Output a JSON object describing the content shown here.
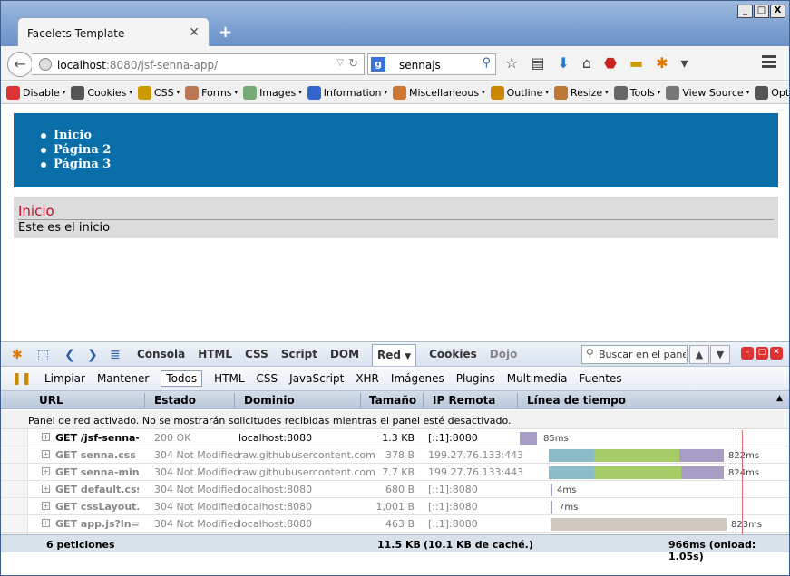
{
  "window": {
    "tab_title": "Facelets Template",
    "controls": [
      "_",
      "□",
      "X"
    ]
  },
  "nav": {
    "url_host": "localhost",
    "url_rest": ":8080/jsf-senna-app/",
    "search_value": "sennajs"
  },
  "webdev_toolbar": [
    {
      "label": "Disable",
      "color": "#d33"
    },
    {
      "label": "Cookies",
      "color": "#555"
    },
    {
      "label": "CSS",
      "color": "#c90"
    },
    {
      "label": "Forms",
      "color": "#b75"
    },
    {
      "label": "Images",
      "color": "#7a7"
    },
    {
      "label": "Information",
      "color": "#36c"
    },
    {
      "label": "Miscellaneous",
      "color": "#c73"
    },
    {
      "label": "Outline",
      "color": "#c80"
    },
    {
      "label": "Resize",
      "color": "#b73"
    },
    {
      "label": "Tools",
      "color": "#666"
    },
    {
      "label": "View Source",
      "color": "#777"
    },
    {
      "label": "Options",
      "color": "#555"
    }
  ],
  "page": {
    "menu": [
      "Inicio",
      "Página 2",
      "Página 3"
    ],
    "panel_title": "Inicio",
    "panel_body": "Este es el inicio"
  },
  "firebug": {
    "tabs": [
      "Consola",
      "HTML",
      "CSS",
      "Script",
      "DOM",
      "Red",
      "Cookies",
      "Dojo"
    ],
    "active_tab": "Red",
    "search_placeholder": "Buscar en el panel R",
    "sub_buttons": [
      "Limpiar",
      "Mantener"
    ],
    "filters": [
      "Todos",
      "HTML",
      "CSS",
      "JavaScript",
      "XHR",
      "Imágenes",
      "Plugins",
      "Multimedia",
      "Fuentes"
    ],
    "headers": {
      "url": "URL",
      "status": "Estado",
      "domain": "Dominio",
      "size": "Tamaño",
      "ip": "IP Remota",
      "timeline": "Línea de tiempo"
    },
    "notice": "Panel de red activado. No se mostrarán solicitudes recibidas mientras el panel esté desactivado.",
    "requests": [
      {
        "url": "GET /jsf-senna-a",
        "status": "200 OK",
        "domain": "localhost:8080",
        "size": "1.3 KB",
        "ip": "[::1]:8080",
        "time": "85ms"
      },
      {
        "url": "GET senna.css",
        "status": "304 Not Modified",
        "domain": "raw.githubusercontent.com",
        "size": "378 B",
        "ip": "199.27.76.133:443",
        "time": "822ms"
      },
      {
        "url": "GET senna-min.j",
        "status": "304 Not Modified",
        "domain": "raw.githubusercontent.com",
        "size": "7.7 KB",
        "ip": "199.27.76.133:443",
        "time": "824ms"
      },
      {
        "url": "GET default.css?",
        "status": "304 Not Modified",
        "domain": "localhost:8080",
        "size": "680 B",
        "ip": "[::1]:8080",
        "time": "4ms"
      },
      {
        "url": "GET cssLayout.c",
        "status": "304 Not Modified",
        "domain": "localhost:8080",
        "size": "1,001 B",
        "ip": "[::1]:8080",
        "time": "7ms"
      },
      {
        "url": "GET app.js?ln=js",
        "status": "304 Not Modified",
        "domain": "localhost:8080",
        "size": "463 B",
        "ip": "[::1]:8080",
        "time": "823ms"
      }
    ],
    "footer": {
      "count": "6 peticiones",
      "size": "11.5 KB",
      "cache": "(10.1 KB de caché.)",
      "total": "966ms (onload: 1.05s)"
    }
  }
}
